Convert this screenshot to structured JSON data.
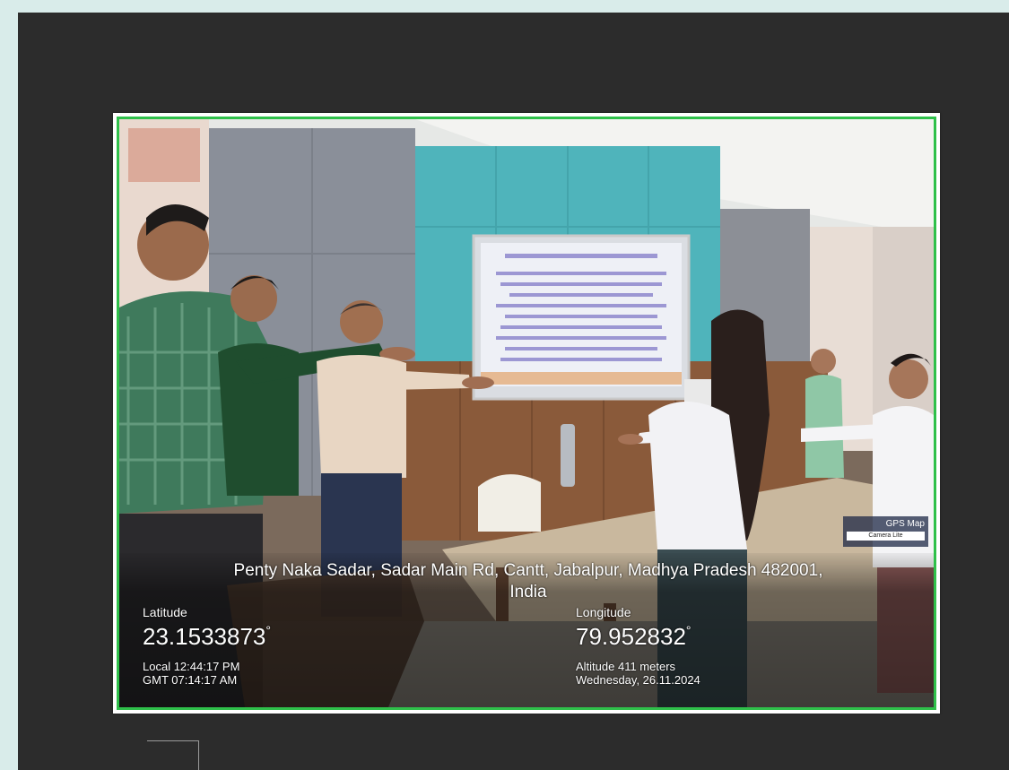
{
  "photo": {
    "gps_badge": {
      "title": "GPS Map",
      "subtitle": "Camera Lite"
    },
    "geo_overlay": {
      "address_line1": "Penty Naka Sadar, Sadar Main Rd, Cantt, Jabalpur, Madhya Pradesh 482001,",
      "address_line2": "India",
      "latitude_label": "Latitude",
      "latitude_value": "23.1533873",
      "longitude_label": "Longitude",
      "longitude_value": "79.952832",
      "degree_symbol": "°",
      "local_time": "Local 12:44:17 PM",
      "gmt_time": "GMT 07:14:17 AM",
      "altitude": "Altitude 411 meters",
      "date": "Wednesday, 26.11.2024"
    },
    "colors": {
      "frame_border": "#2fc04a",
      "viewer_background": "#2c2c2c",
      "page_background": "#d9ecea"
    }
  }
}
